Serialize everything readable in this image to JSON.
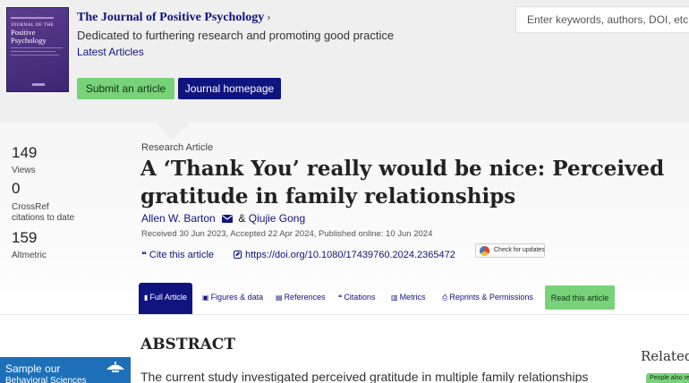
{
  "journal": {
    "cover_title_small": "JOURNAL OF THE",
    "cover_title": "Positive Psychology",
    "title": "The Journal of Positive Psychology",
    "chevron": "›",
    "description": "Dedicated to furthering research and promoting good practice",
    "latest_link": "Latest Articles",
    "submit_button": "Submit an article",
    "homepage_button": "Journal homepage"
  },
  "search": {
    "placeholder": "Enter keywords, authors, DOI, etc"
  },
  "metrics": [
    {
      "value": "149",
      "label": "Views"
    },
    {
      "value": "0",
      "label": "CrossRef citations to date"
    },
    {
      "value": "159",
      "label": "Altmetric"
    }
  ],
  "article": {
    "type": "Research Article",
    "title": "A ‘Thank You’ really would be nice: Perceived gratitude in family relationships",
    "author1": "Allen W. Barton",
    "author_sep": "&",
    "author2": "Qiujie Gong",
    "dates": "Received 30 Jun 2023, Accepted 22 Apr 2024, Published online: 10 Jun 2024",
    "cite_link": "Cite this article",
    "doi_link": "https://doi.org/10.1080/17439760.2024.2365472",
    "updates_label": "Check for updates"
  },
  "tabs": [
    {
      "label": "Full Article",
      "icon": "▮",
      "active": true
    },
    {
      "label": "Figures & data",
      "icon": "▣"
    },
    {
      "label": "References",
      "icon": "▤"
    },
    {
      "label": "Citations",
      "icon": "❝"
    },
    {
      "label": "Metrics",
      "icon": "▥"
    },
    {
      "label": "Reprints & Permissions",
      "icon": "⎙"
    }
  ],
  "read_button": "Read this article",
  "abstract": {
    "heading": "ABSTRACT",
    "text": "The current study investigated perceived gratitude in multiple family relationships"
  },
  "related": {
    "heading": "Related",
    "tab": "People also read"
  },
  "promo": {
    "line1": "Sample our",
    "line2": "Behavioral Sciences"
  },
  "colors": {
    "brand": "#10147e",
    "accent_green": "#78d27a",
    "promo_blue": "#1d6fb8"
  }
}
